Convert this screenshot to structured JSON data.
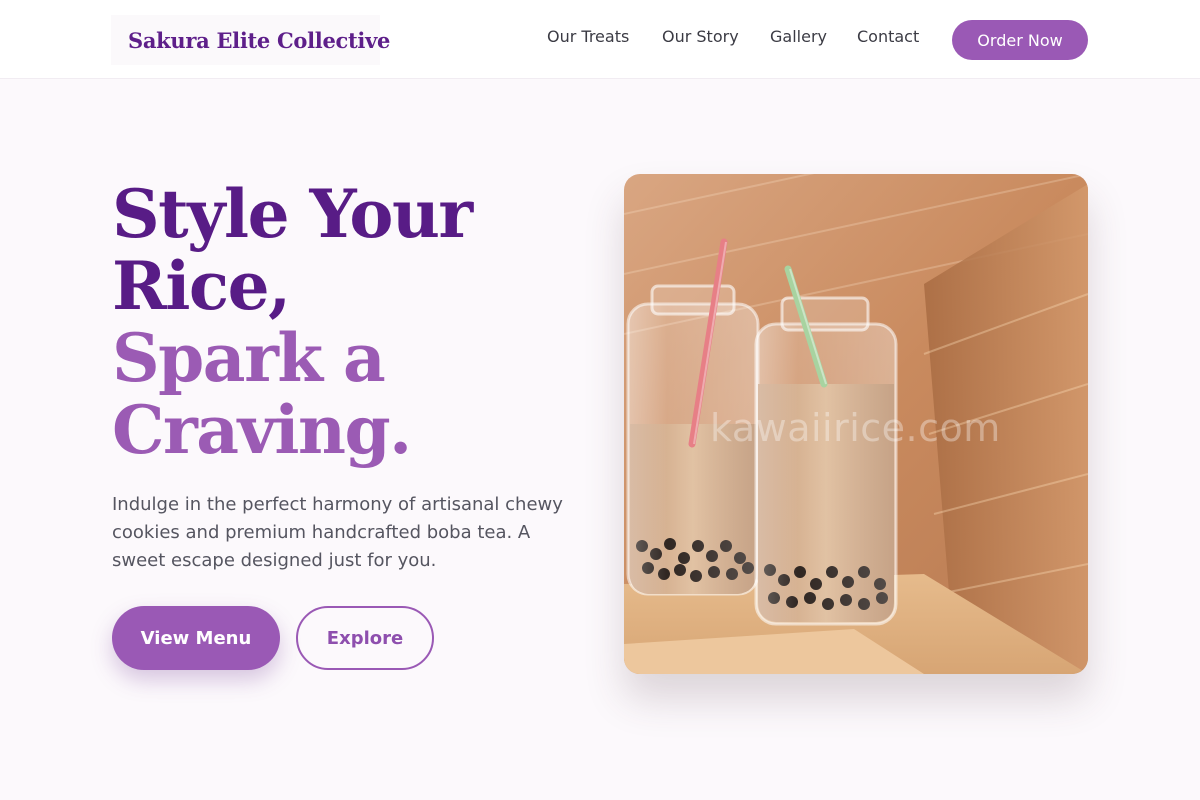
{
  "header": {
    "logo": "Sakura Elite Collective",
    "nav": [
      "Our Treats",
      "Our Story",
      "Gallery",
      "Contact"
    ],
    "cta": "Order Now"
  },
  "hero": {
    "title_lines": [
      "Style Your",
      "Rice,",
      "Spark a",
      "Craving."
    ],
    "description": "Indulge in the perfect harmony of artisanal chewy cookies and premium handcrafted boba tea. A sweet escape designed just for you.",
    "primary_button": "View Menu",
    "secondary_button": "Explore",
    "image_watermark": "kawaiirice.com",
    "image_subject": "two glass jars of milk boba tea with straws"
  },
  "colors": {
    "brand_dark": "#581c86",
    "brand_accent": "#9a59b5",
    "background": "#fcf9fc",
    "text_body": "#555560"
  }
}
